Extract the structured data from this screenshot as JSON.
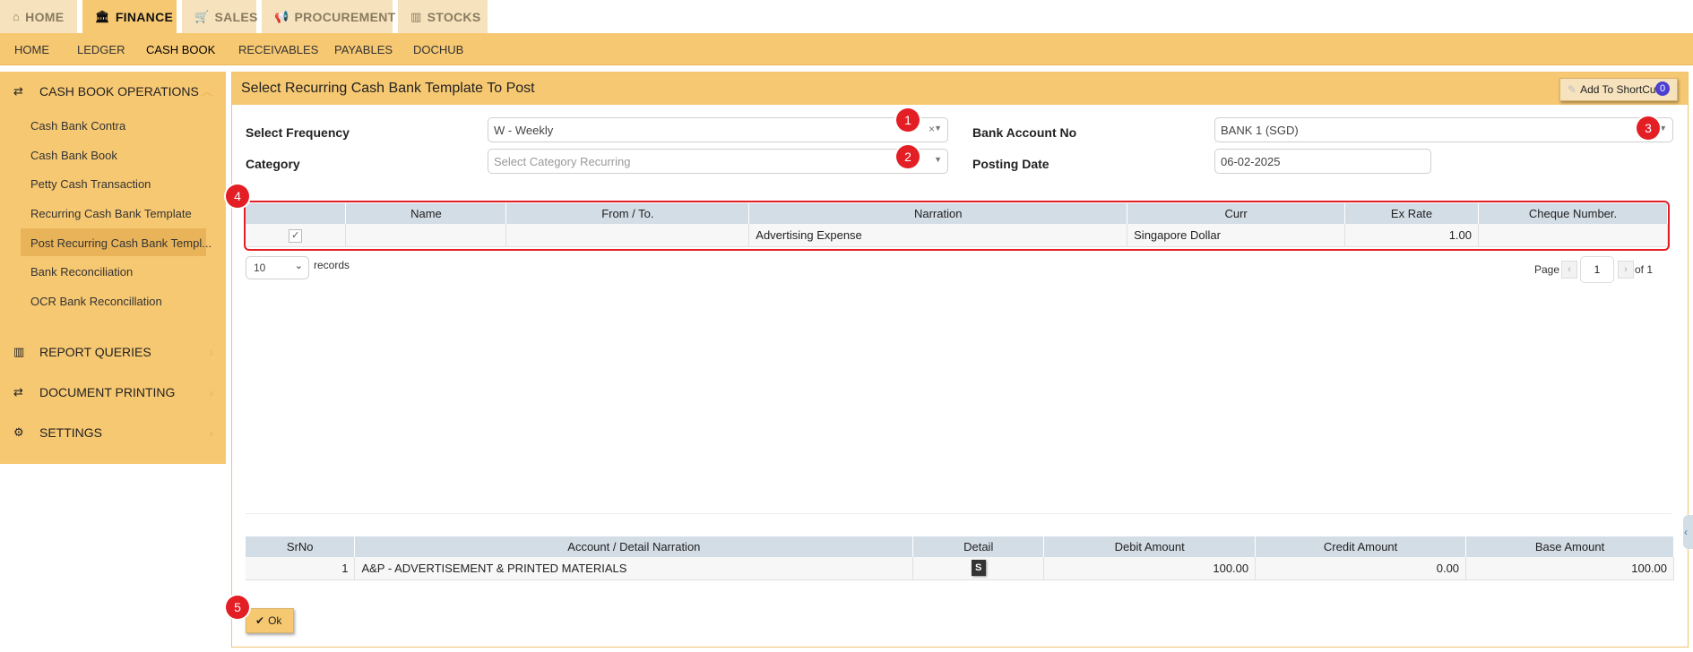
{
  "top_tabs": [
    {
      "label": "HOME",
      "icon": "home-icon"
    },
    {
      "label": "FINANCE",
      "icon": "bank-icon"
    },
    {
      "label": "SALES",
      "icon": "cart-icon"
    },
    {
      "label": "PROCUREMENT",
      "icon": "megaphone-icon"
    },
    {
      "label": "STOCKS",
      "icon": "bar-chart-icon"
    }
  ],
  "sub_nav": [
    "HOME",
    "LEDGER",
    "CASH BOOK",
    "RECEIVABLES",
    "PAYABLES",
    "DOCHUB"
  ],
  "sidebar": {
    "sections": [
      {
        "label": "CASH BOOK OPERATIONS",
        "icon": "transfer-icon"
      },
      {
        "label": "REPORT QUERIES",
        "icon": "bar-chart-icon"
      },
      {
        "label": "DOCUMENT PRINTING",
        "icon": "transfer-icon"
      },
      {
        "label": "SETTINGS",
        "icon": "gears-icon"
      }
    ],
    "items": [
      "Cash Bank Contra",
      "Cash Bank Book",
      "Petty Cash Transaction",
      "Recurring Cash Bank Template",
      "Post Recurring Cash Bank Templ...",
      "Bank Reconciliation",
      "OCR Bank Reconcillation"
    ]
  },
  "main": {
    "title": "Select Recurring Cash Bank Template To Post",
    "shortcut_label": "Add To ShortCut",
    "shortcut_count": "0",
    "form": {
      "frequency_label": "Select Frequency",
      "frequency_value": "W - Weekly",
      "category_label": "Category",
      "category_placeholder": "Select Category Recurring",
      "bank_label": "Bank Account No",
      "bank_value": "BANK 1 (SGD)",
      "posting_label": "Posting Date",
      "posting_value": "06-02-2025"
    },
    "template_table": {
      "headers": [
        "",
        "Name",
        "From / To.",
        "Narration",
        "Curr",
        "Ex Rate",
        "Cheque Number."
      ],
      "row": {
        "name": "",
        "from_to": "",
        "narration": "Advertising Expense",
        "curr": "Singapore Dollar",
        "ex_rate": "1.00",
        "cheque": ""
      }
    },
    "page_size": "10",
    "records_label": "records",
    "pager": {
      "page_label": "Page",
      "page": "1",
      "of_label": "of 1"
    },
    "detail_table": {
      "headers": [
        "SrNo",
        "Account / Detail Narration",
        "Detail",
        "Debit Amount",
        "Credit Amount",
        "Base Amount"
      ],
      "row": {
        "srno": "1",
        "account": "A&P - ADVERTISEMENT & PRINTED MATERIALS",
        "detail": "S",
        "debit": "100.00",
        "credit": "0.00",
        "base": "100.00"
      }
    },
    "ok_label": "Ok"
  },
  "badges": [
    "1",
    "2",
    "3",
    "4",
    "5"
  ],
  "colors": {
    "accent": "#f7c872",
    "accent_light": "#f6e3bd",
    "header_grid": "#d3dde6",
    "badge_red": "#e31e24"
  }
}
